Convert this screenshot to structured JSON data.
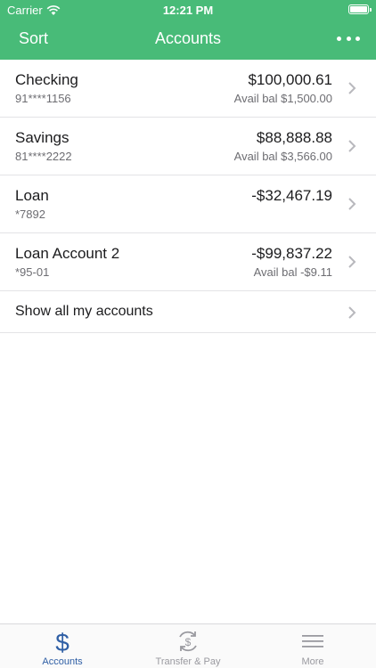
{
  "status_bar": {
    "carrier": "Carrier",
    "time": "12:21 PM"
  },
  "nav": {
    "sort_label": "Sort",
    "title": "Accounts"
  },
  "accounts": [
    {
      "name": "Checking",
      "number": "91****1156",
      "balance": "$100,000.61",
      "available": "Avail bal $1,500.00"
    },
    {
      "name": "Savings",
      "number": "81****2222",
      "balance": "$88,888.88",
      "available": "Avail bal $3,566.00"
    },
    {
      "name": "Loan",
      "number": "*7892",
      "balance": "-$32,467.19",
      "available": ""
    },
    {
      "name": "Loan Account 2",
      "number": "*95-01",
      "balance": "-$99,837.22",
      "available": "Avail bal -$9.11"
    }
  ],
  "show_all_label": "Show all my accounts",
  "tabs": [
    {
      "label": "Accounts",
      "icon": "dollar-icon",
      "active": true
    },
    {
      "label": "Transfer & Pay",
      "icon": "transfer-dollar-icon",
      "active": false
    },
    {
      "label": "More",
      "icon": "menu-icon",
      "active": false
    }
  ],
  "colors": {
    "header": "#48bb78",
    "active_tab": "#2f5fa5",
    "inactive_tab": "#9a9aa0"
  }
}
